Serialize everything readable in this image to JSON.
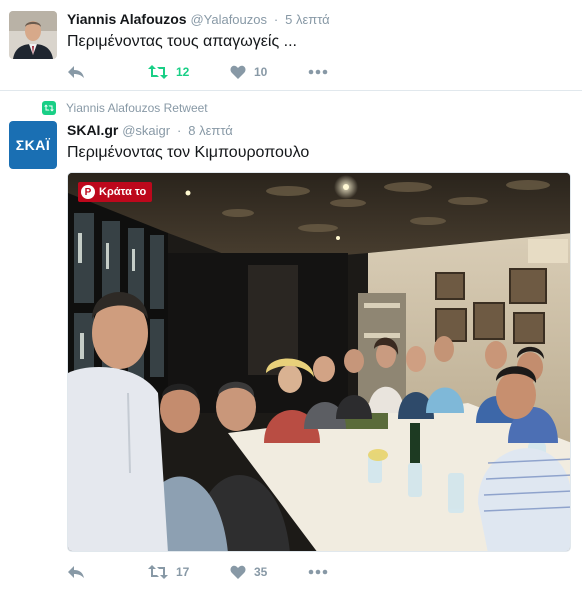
{
  "tweets": [
    {
      "name": "Yiannis Alafouzos",
      "handle": "@Yalafouzos",
      "time": "5 λεπτά",
      "text": "Περιμένοντας τους απαγωγείς ...",
      "retweets": "12",
      "likes": "10",
      "retweeted": true
    },
    {
      "retweet_context": "Yiannis Alafouzos Retweet",
      "name": "SKAI.gr",
      "handle": "@skaigr",
      "time": "8 λεπτά",
      "text": "Περιμένοντας τον Κιμπουροπουλο",
      "avatar_logo": "ΣΚΑΪ",
      "media_button": "Κράτα το",
      "retweets": "17",
      "likes": "35"
    }
  ],
  "colors": {
    "retweet_green": "#19cf86",
    "muted": "#8899a6",
    "skai_blue": "#1a6fb3",
    "pinterest_red": "#bd081c"
  },
  "icons": [
    "reply-icon",
    "retweet-icon",
    "heart-icon",
    "more-icon",
    "pinterest-icon"
  ]
}
